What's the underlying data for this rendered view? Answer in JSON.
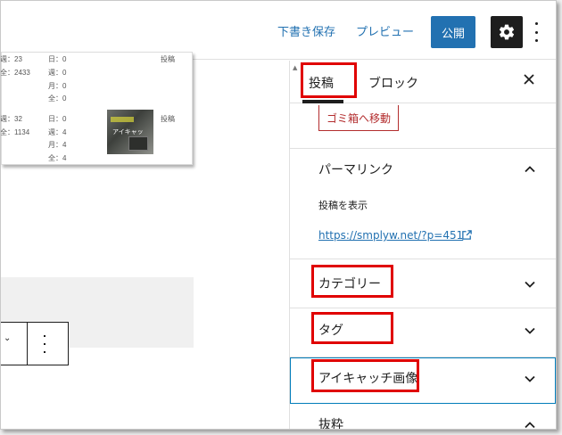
{
  "header": {
    "save_draft": "下書き保存",
    "preview": "プレビュー",
    "publish": "公開"
  },
  "stats_card": {
    "rows": [
      {
        "col1": "週：23",
        "col2": "日：0",
        "col2b": "週：0",
        "col2c": "月：0",
        "col2d": "全：0",
        "col1b": "全：2433",
        "type": "投稿"
      },
      {
        "col1": "週：32",
        "col1b": "全：1134",
        "col2": "日：0",
        "col2b": "週：4",
        "col2c": "月：4",
        "col2d": "全：4",
        "type": "投稿"
      }
    ],
    "thumbnail_label": "アイキャッ"
  },
  "sidebar": {
    "tabs": {
      "post": "投稿",
      "block": "ブロック"
    },
    "trash_button": "ゴミ箱へ移動",
    "permalink": {
      "title": "パーマリンク",
      "view_post_label": "投稿を表示",
      "url": "https://smplyw.net/?p=451"
    },
    "panels": {
      "categories": "カテゴリー",
      "tags": "タグ",
      "featured_image": "アイキャッチ画像",
      "excerpt": "抜粋"
    }
  },
  "colors": {
    "accent": "#2271b1",
    "focus": "#007cba",
    "danger": "#b32d2e",
    "annotation_red": "#e00000",
    "dark": "#1e1e1e"
  },
  "icons": [
    "gear-icon",
    "more-vertical-icon",
    "close-icon",
    "chevron-up-icon",
    "chevron-down-icon",
    "external-link-icon"
  ]
}
